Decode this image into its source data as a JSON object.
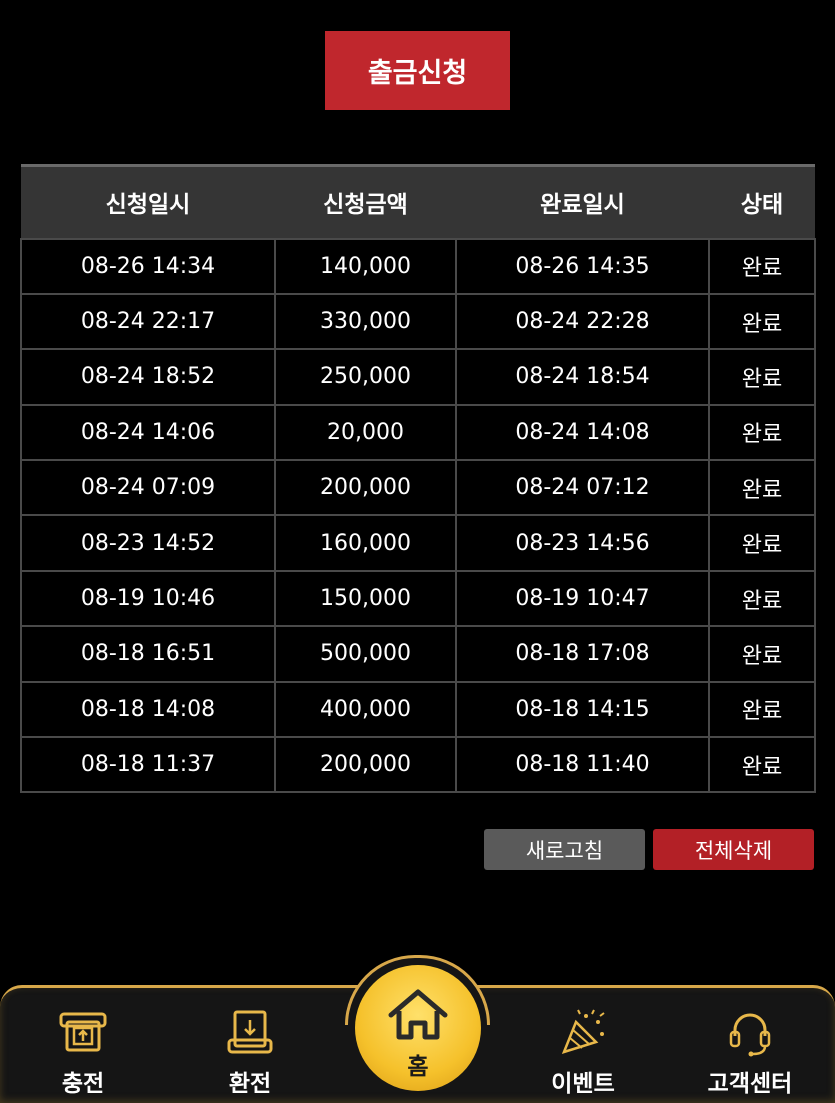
{
  "header": {
    "withdraw_button_label": "출금신청"
  },
  "table": {
    "columns": [
      "신청일시",
      "신청금액",
      "완료일시",
      "상태"
    ],
    "rows": [
      [
        "08-26 14:34",
        "140,000",
        "08-26 14:35",
        "완료"
      ],
      [
        "08-24 22:17",
        "330,000",
        "08-24 22:28",
        "완료"
      ],
      [
        "08-24 18:52",
        "250,000",
        "08-24 18:54",
        "완료"
      ],
      [
        "08-24 14:06",
        "20,000",
        "08-24 14:08",
        "완료"
      ],
      [
        "08-24 07:09",
        "200,000",
        "08-24 07:12",
        "완료"
      ],
      [
        "08-23 14:52",
        "160,000",
        "08-23 14:56",
        "완료"
      ],
      [
        "08-19 10:46",
        "150,000",
        "08-19 10:47",
        "완료"
      ],
      [
        "08-18 16:51",
        "500,000",
        "08-18 17:08",
        "완료"
      ],
      [
        "08-18 14:08",
        "400,000",
        "08-18 14:15",
        "완료"
      ],
      [
        "08-18 11:37",
        "200,000",
        "08-18 11:40",
        "완료"
      ]
    ]
  },
  "actions": {
    "refresh_label": "새로고침",
    "delete_all_label": "전체삭제"
  },
  "bottom_nav": {
    "charge": {
      "label": "충전",
      "icon": "deposit-icon"
    },
    "exchange": {
      "label": "환전",
      "icon": "withdraw-icon"
    },
    "home": {
      "label": "홈",
      "icon": "home-icon"
    },
    "event": {
      "label": "이벤트",
      "icon": "party-icon"
    },
    "support": {
      "label": "고객센터",
      "icon": "headset-icon"
    }
  },
  "colors": {
    "accent_red": "#c0272d",
    "gold": "#f5c12b",
    "gold_border": "#d8a84a",
    "header_gray": "#353535"
  }
}
